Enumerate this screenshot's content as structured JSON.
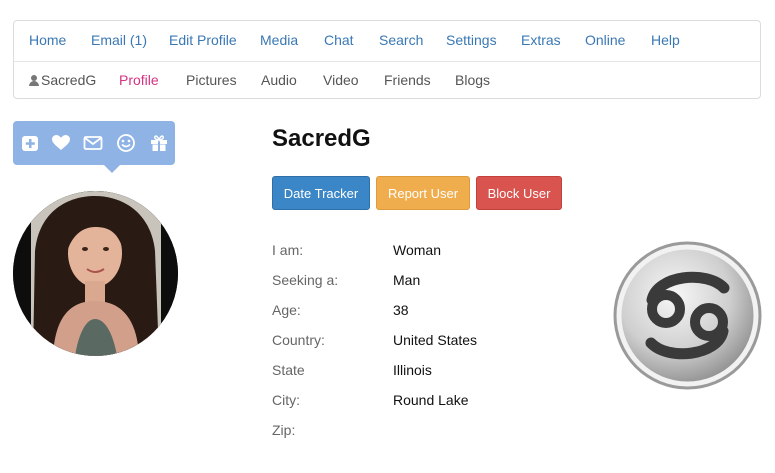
{
  "nav": {
    "primary": [
      {
        "label": "Home"
      },
      {
        "label": "Email (1)"
      },
      {
        "label": "Edit Profile"
      },
      {
        "label": "Media"
      },
      {
        "label": "Chat"
      },
      {
        "label": "Search"
      },
      {
        "label": "Settings"
      },
      {
        "label": "Extras"
      },
      {
        "label": "Online"
      },
      {
        "label": "Help"
      }
    ],
    "secondary": [
      {
        "label": "SacredG",
        "icon": "user-icon"
      },
      {
        "label": "Profile",
        "active": true
      },
      {
        "label": "Pictures"
      },
      {
        "label": "Audio"
      },
      {
        "label": "Video"
      },
      {
        "label": "Friends"
      },
      {
        "label": "Blogs"
      }
    ]
  },
  "action_icons": [
    "add-icon",
    "heart-icon",
    "mail-icon",
    "smile-icon",
    "gift-icon"
  ],
  "profile": {
    "username": "SacredG",
    "buttons": {
      "tracker": "Date Tracker",
      "report": "Report User",
      "block": "Block User"
    },
    "fields": [
      {
        "label": "I am:",
        "value": "Woman"
      },
      {
        "label": "Seeking a:",
        "value": "Man"
      },
      {
        "label": "Age:",
        "value": "38"
      },
      {
        "label": "Country:",
        "value": "United States"
      },
      {
        "label": "State",
        "value": "Illinois"
      },
      {
        "label": "City:",
        "value": "Round Lake"
      },
      {
        "label": "Zip:",
        "value": ""
      }
    ],
    "zodiac_icon": "cancer-zodiac-icon"
  },
  "colors": {
    "link": "#3a78b5",
    "active": "#d63384",
    "action_bar": "#8fb3e4",
    "btn_primary": "#3b86c6",
    "btn_warning": "#f0ad4e",
    "btn_danger": "#d9534f"
  }
}
